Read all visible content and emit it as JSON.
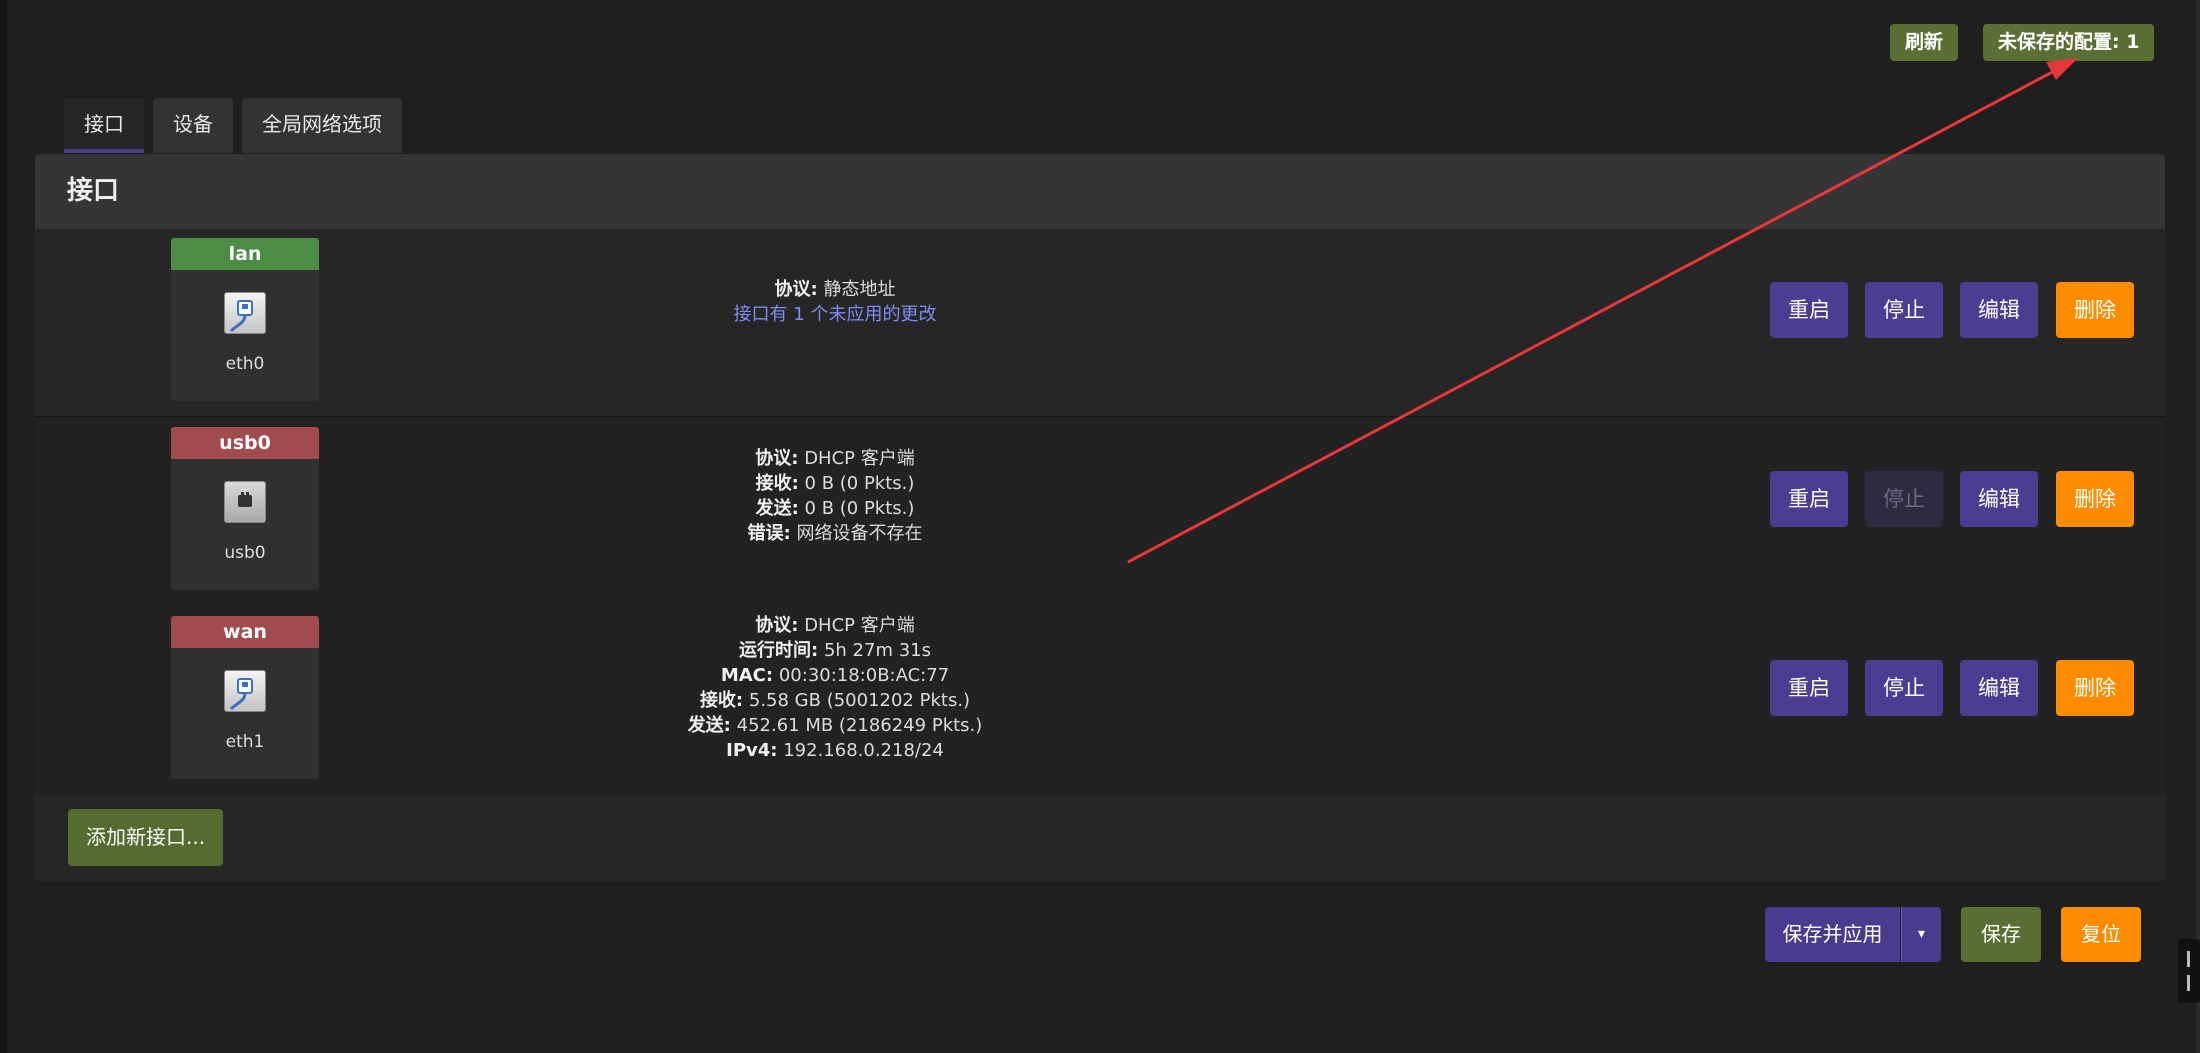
{
  "header": {
    "refresh_label": "刷新",
    "unsaved_label": "未保存的配置: 1"
  },
  "tabs": [
    {
      "label": "接口",
      "active": true
    },
    {
      "label": "设备",
      "active": false
    },
    {
      "label": "全局网络选项",
      "active": false
    }
  ],
  "section_title": "接口",
  "interfaces": [
    {
      "name": "lan",
      "name_color": "#4c8c45",
      "icon": "ethernet-port-icon",
      "device": "eth0",
      "protocol_label": "协议:",
      "protocol_value": "静态地址",
      "pending_note": "接口有 1 个未应用的更改",
      "actions": {
        "restart": "重启",
        "stop": "停止",
        "edit": "编辑",
        "delete": "删除"
      },
      "stop_disabled": false
    },
    {
      "name": "usb0",
      "name_color": "#a24b4e",
      "icon": "usb-device-icon",
      "device": "usb0",
      "lines": [
        {
          "label": "协议:",
          "value": "DHCP 客户端"
        },
        {
          "label": "接收:",
          "value": "0 B (0 Pkts.)"
        },
        {
          "label": "发送:",
          "value": "0 B (0 Pkts.)"
        },
        {
          "label": "错误:",
          "value": "网络设备不存在"
        }
      ],
      "actions": {
        "restart": "重启",
        "stop": "停止",
        "edit": "编辑",
        "delete": "删除"
      },
      "stop_disabled": true
    },
    {
      "name": "wan",
      "name_color": "#a24b4e",
      "icon": "ethernet-port-icon",
      "device": "eth1",
      "lines": [
        {
          "label": "协议:",
          "value": "DHCP 客户端"
        },
        {
          "label": "运行时间:",
          "value": "5h 27m 31s"
        },
        {
          "label": "MAC:",
          "value": "00:30:18:0B:AC:77"
        },
        {
          "label": "接收:",
          "value": "5.58 GB (5001202 Pkts.)"
        },
        {
          "label": "发送:",
          "value": "452.61 MB (2186249 Pkts.)"
        },
        {
          "label": "IPv4:",
          "value": "192.168.0.218/24"
        }
      ],
      "actions": {
        "restart": "重启",
        "stop": "停止",
        "edit": "编辑",
        "delete": "删除"
      },
      "stop_disabled": false
    }
  ],
  "add_interface_label": "添加新接口...",
  "footer": {
    "save_apply_label": "保存并应用",
    "dropdown_glyph": "▾",
    "save_label": "保存",
    "reset_label": "复位"
  },
  "colors": {
    "primary": "#4c3d92",
    "warning": "#ff8c00",
    "success": "#5a6f33",
    "annotation_arrow": "#e8373a"
  }
}
